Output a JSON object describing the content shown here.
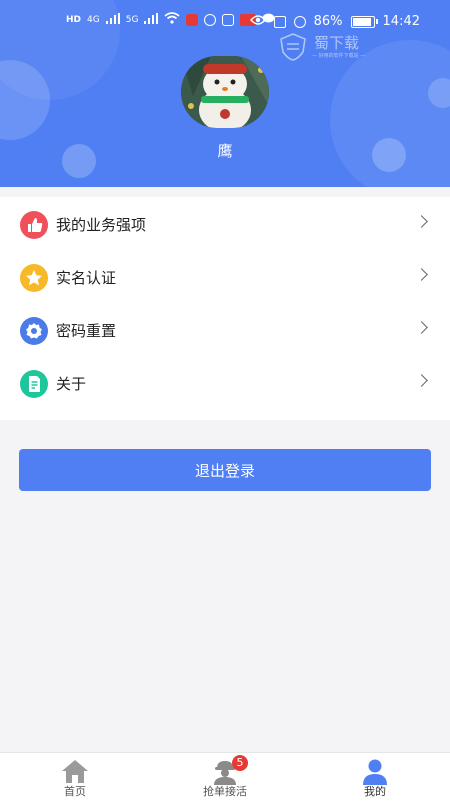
{
  "status_bar": {
    "left_labels": [
      "HD",
      "4G",
      "5G",
      "HD"
    ],
    "battery_percent": "86%",
    "battery_level": 0.86,
    "time": "14:42"
  },
  "watermark": {
    "title": "蜀下载",
    "subtitle": "— 好用的软件下载站 —"
  },
  "profile": {
    "username": "鹰"
  },
  "menu": {
    "items": [
      {
        "label": "我的业务强项",
        "icon": "thumbs-up-icon",
        "color": "#f0505a"
      },
      {
        "label": "实名认证",
        "icon": "star-icon",
        "color": "#f7b928"
      },
      {
        "label": "密码重置",
        "icon": "gear-icon",
        "color": "#4a7be8"
      },
      {
        "label": "关于",
        "icon": "document-icon",
        "color": "#1ec79b"
      }
    ]
  },
  "logout_label": "退出登录",
  "tabbar": {
    "tabs": [
      {
        "label": "首页",
        "icon": "home-icon"
      },
      {
        "label": "抢单接活",
        "icon": "worker-icon",
        "badge": "5"
      },
      {
        "label": "我的",
        "icon": "user-icon"
      }
    ],
    "active_index": 2
  },
  "colors": {
    "primary": "#4f7ff3",
    "background": "#f4f4f6",
    "badge": "#e53935"
  }
}
